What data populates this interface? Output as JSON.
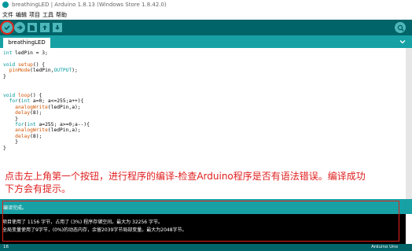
{
  "window": {
    "title": "breathingLED | Arduino 1.8.13 (Windows Store 1.8.42.0)"
  },
  "menu": [
    "文件",
    "编辑",
    "项目",
    "工具",
    "帮助"
  ],
  "toolbar": {
    "verify": "verify-icon",
    "upload": "upload-icon",
    "new": "new-icon",
    "open": "open-icon",
    "save": "save-icon",
    "serial_monitor": "serial-monitor-icon"
  },
  "tab": {
    "label": "breathingLED"
  },
  "code": [
    "int ledPin = 3;",
    "",
    "void setup() {",
    "  pinMode(ledPin,OUTPUT);",
    "}",
    "",
    "void loop() {",
    "  for(int a=0; a<=255;a++){",
    "    analogWrite(ledPin,a);",
    "    delay(8);",
    "    }",
    "    for(int a=255; a>=0;a--){",
    "    analogWrite(ledPin,a);",
    "    delay(8);",
    "    }",
    "}"
  ],
  "annotation": "点击左上角第一个按钮，进行程序的编译-检查Arduino程序是否有语法错误。编译成功下方会有提示。",
  "status": {
    "message": "编译完成。"
  },
  "console": [
    "项目使用了 1156 字节，占用了 (3%) 程序存储空间。最大为 32256 字节。",
    "全局变量使用了9字节，(0%)的动态内存，余留2039字节局部变量。最大为2048字节。"
  ],
  "bottom": {
    "line": "16",
    "board": "Arduino Uno"
  },
  "colors": {
    "toolbar": "#006468",
    "tabbar": "#17a1a5",
    "highlight": "#e62117",
    "annotation": "#e02020"
  }
}
